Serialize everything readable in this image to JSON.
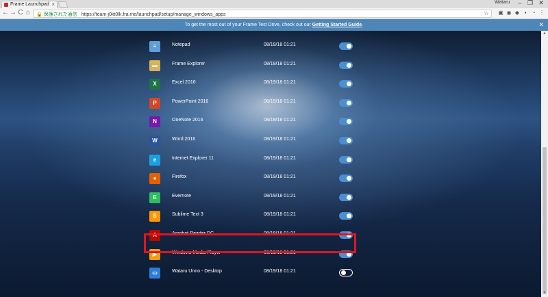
{
  "browser": {
    "tab_title": "Frame Launchpad",
    "tab_close": "×",
    "user_label": "Wataru",
    "secure_label": "保護された通信",
    "url": "https://team-j0kt0lk.fra.me/launchpad/setup/manage_windows_apps",
    "win_min": "–",
    "win_max": "❐",
    "win_close": "✕",
    "back": "←",
    "forward": "→",
    "reload": "C",
    "home": "⌂",
    "star": "☆",
    "menu": "⋮"
  },
  "banner": {
    "text_before": "To get the most out of your Frame Test Drive, check out our ",
    "link": "Getting Started Guide",
    "text_after": "."
  },
  "apps": [
    {
      "name": "Notepad",
      "date": "08/19/18 01:21",
      "enabled": true,
      "icon": "notepad-icon",
      "glyph": "≡",
      "color": "#5f9fd6"
    },
    {
      "name": "Frame Explorer",
      "date": "08/19/18 01:21",
      "enabled": true,
      "icon": "folder-icon",
      "glyph": "▬",
      "color": "#d8b25a"
    },
    {
      "name": "Excel 2016",
      "date": "08/19/18 01:21",
      "enabled": true,
      "icon": "excel-icon",
      "glyph": "X",
      "color": "#217346"
    },
    {
      "name": "PowerPoint 2016",
      "date": "08/19/18 01:21",
      "enabled": true,
      "icon": "powerpoint-icon",
      "glyph": "P",
      "color": "#d24726"
    },
    {
      "name": "OneNote 2016",
      "date": "08/19/18 01:21",
      "enabled": true,
      "icon": "onenote-icon",
      "glyph": "N",
      "color": "#7719aa"
    },
    {
      "name": "Word 2016",
      "date": "08/19/18 01:21",
      "enabled": true,
      "icon": "word-icon",
      "glyph": "W",
      "color": "#2b579a"
    },
    {
      "name": "Internet Explorer 11",
      "date": "08/19/18 01:21",
      "enabled": true,
      "icon": "internet-explorer-icon",
      "glyph": "e",
      "color": "#1ba1e2"
    },
    {
      "name": "Firefox",
      "date": "08/19/18 01:21",
      "enabled": true,
      "icon": "firefox-icon",
      "glyph": "●",
      "color": "#e66000"
    },
    {
      "name": "Evernote",
      "date": "08/19/18 01:21",
      "enabled": true,
      "icon": "evernote-icon",
      "glyph": "E",
      "color": "#2dbe60"
    },
    {
      "name": "Sublime Text 3",
      "date": "08/19/18 01:21",
      "enabled": true,
      "icon": "sublime-text-icon",
      "glyph": "S",
      "color": "#ff9800"
    },
    {
      "name": "Acrobat Reader DC",
      "date": "08/19/18 01:21",
      "enabled": true,
      "icon": "acrobat-icon",
      "glyph": "A",
      "color": "#b30b00"
    },
    {
      "name": "Windows Media Player",
      "date": "08/19/18 01:21",
      "enabled": true,
      "icon": "media-player-icon",
      "glyph": "▶",
      "color": "#f39c12"
    },
    {
      "name": "Wataru Unno - Desktop",
      "date": "08/19/18 01:21",
      "enabled": false,
      "icon": "desktop-icon",
      "glyph": "▭",
      "color": "#2f7bd8"
    }
  ]
}
